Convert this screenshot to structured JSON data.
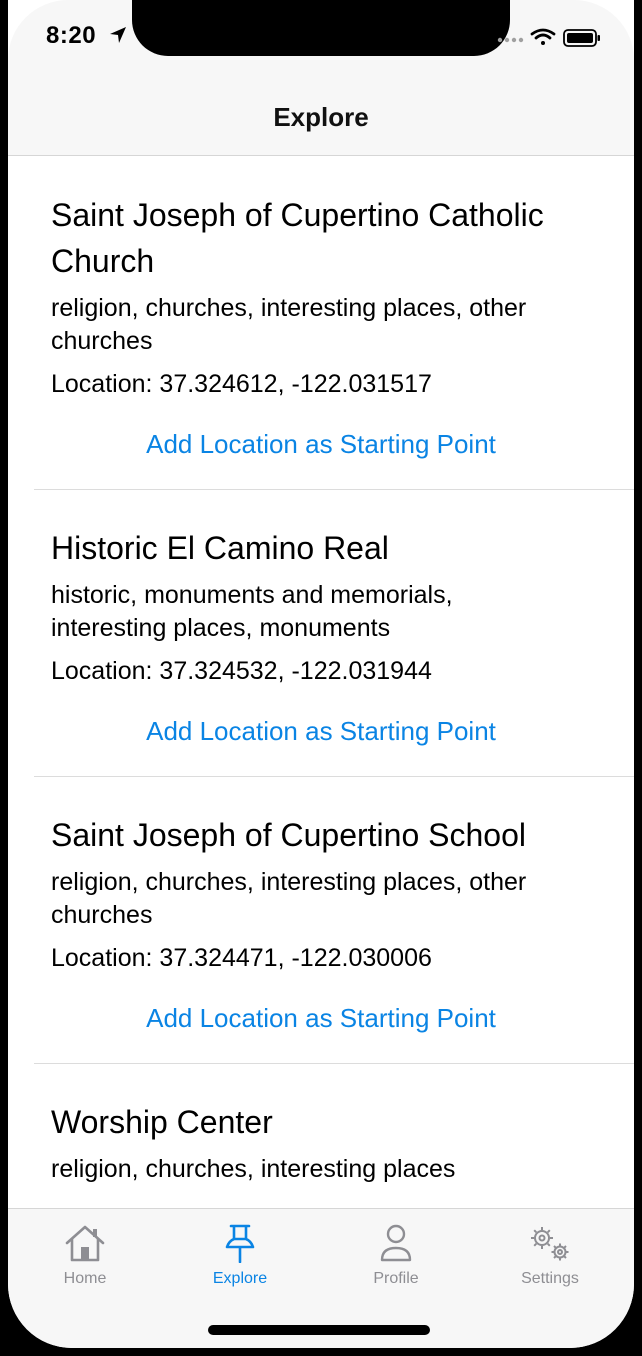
{
  "status_bar": {
    "time": "8:20",
    "icons": [
      "location-arrow-icon",
      "cellular-icon",
      "wifi-icon",
      "battery-icon"
    ]
  },
  "nav": {
    "title": "Explore"
  },
  "places": [
    {
      "name": "Saint Joseph of Cupertino Catholic Church",
      "tags": "religion, churches, interesting places, other churches",
      "location": "Location: 37.324612, -122.031517",
      "action": "Add Location as Starting Point"
    },
    {
      "name": "Historic El Camino Real",
      "tags": "historic, monuments and memorials, interesting places, monuments",
      "location": "Location: 37.324532, -122.031944",
      "action": "Add Location as Starting Point"
    },
    {
      "name": "Saint Joseph of Cupertino School",
      "tags": "religion, churches, interesting places, other churches",
      "location": "Location: 37.324471, -122.030006",
      "action": "Add Location as Starting Point"
    },
    {
      "name": "Worship Center",
      "tags": "religion, churches, interesting places",
      "location": "",
      "action": ""
    }
  ],
  "tabs": [
    {
      "label": "Home",
      "icon": "house-icon",
      "active": false
    },
    {
      "label": "Explore",
      "icon": "pushpin-icon",
      "active": true
    },
    {
      "label": "Profile",
      "icon": "person-icon",
      "active": false
    },
    {
      "label": "Settings",
      "icon": "gears-icon",
      "active": false
    }
  ],
  "colors": {
    "accent": "#0a84e4",
    "inactive": "#8e8e93",
    "bar_bg": "#f7f7f7"
  }
}
